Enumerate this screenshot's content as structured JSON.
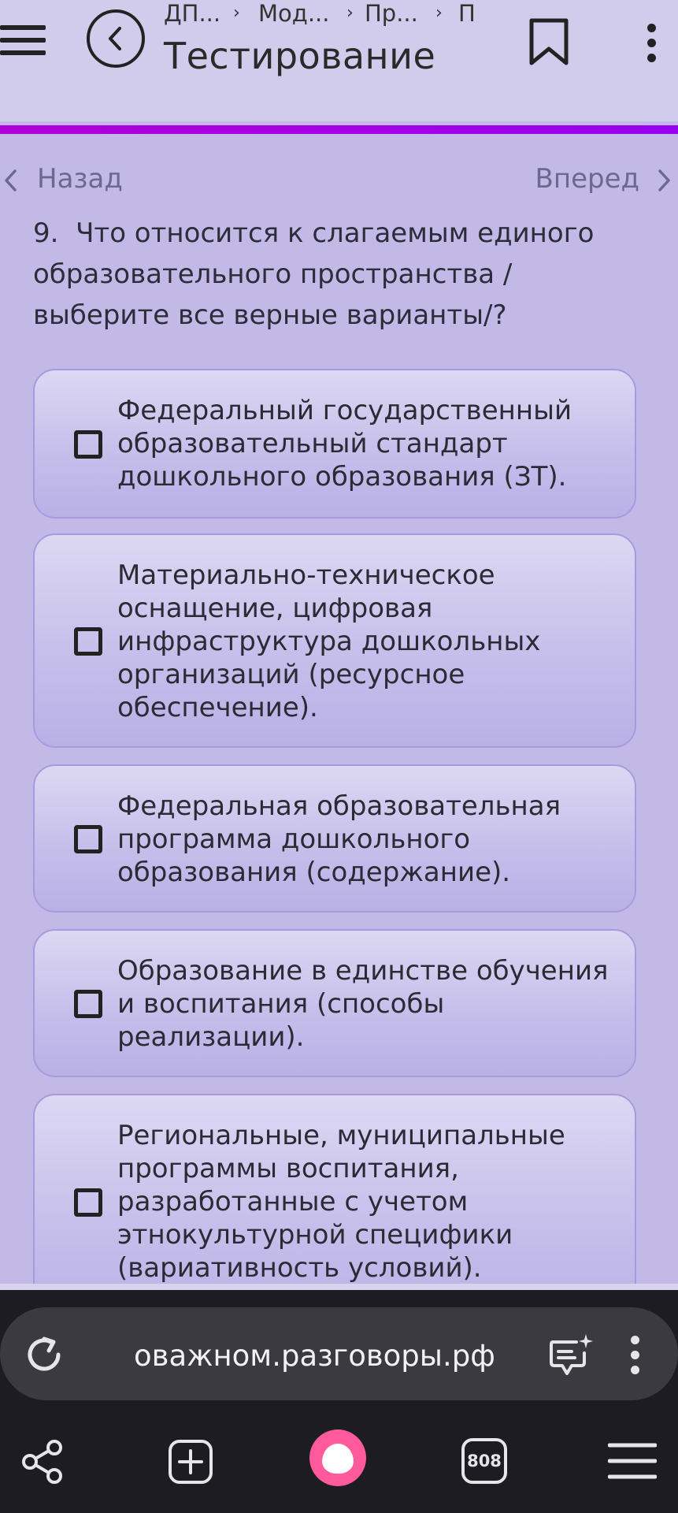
{
  "header": {
    "breadcrumbs": [
      "ДП...",
      "Мод...",
      "Пр...",
      "П"
    ],
    "title": "Тестирование"
  },
  "nav": {
    "prev_label": "Назад",
    "next_label": "Вперед"
  },
  "question": {
    "number": "9.",
    "text": "Что относится к слагаемым единого образовательного пространства / выберите все верные варианты/?"
  },
  "options": [
    {
      "label": "Федеральный государственный образовательный стандарт дошкольного образования (ЗТ).",
      "checked": false
    },
    {
      "label": "Материально-техническое оснащение, цифровая инфраструктура дошкольных организаций (ресурсное обеспечение).",
      "checked": false
    },
    {
      "label": "Федеральная образовательная программа дошкольного образования (содержание).",
      "checked": false
    },
    {
      "label": "Образование в единстве обучения и воспитания (способы реализации).",
      "checked": false
    },
    {
      "label": "Региональные, муниципальные программы воспитания, разработанные с учетом этнокультурной специфики (вариативность условий).",
      "checked": false
    }
  ],
  "browser": {
    "url": "оважном.разговоры.рф",
    "tabs_count": "808"
  },
  "colors": {
    "page_bg": "#c2b9e6",
    "header_bg": "#d1ccec",
    "accent": "#b000d8",
    "option_border": "#a79be0",
    "browser_bg": "#1d1c22",
    "alice": "#ff5a9b"
  },
  "icons": [
    "menu-icon",
    "back-arrow-icon",
    "bookmark-icon",
    "more-vertical-icon",
    "chevron-left-icon",
    "chevron-right-icon",
    "checkbox-icon",
    "reload-icon",
    "chat-sparkle-icon",
    "share-icon",
    "new-tab-icon",
    "alice-icon",
    "tabs-icon",
    "hamburger-icon"
  ]
}
